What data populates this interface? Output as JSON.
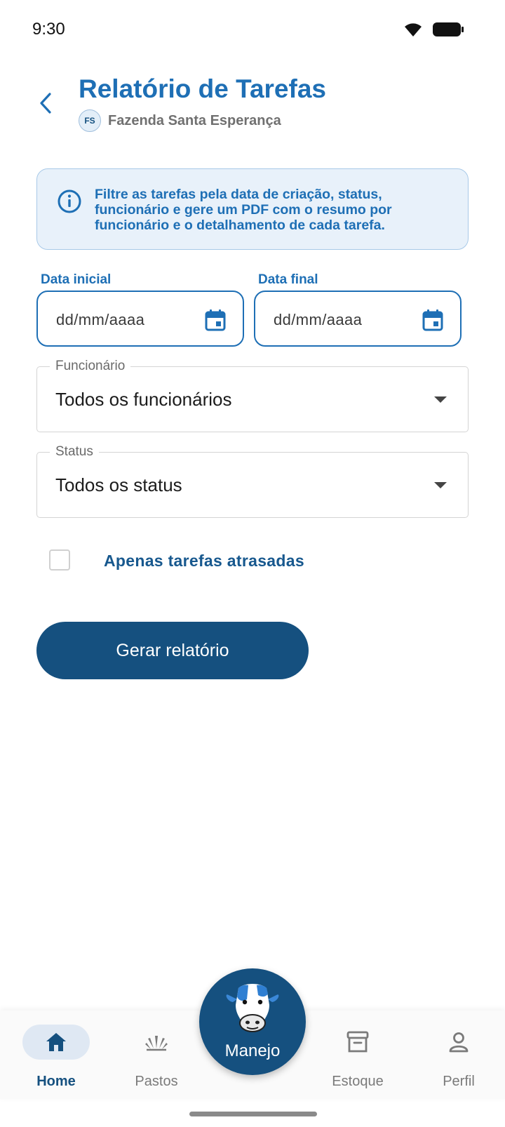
{
  "status_bar": {
    "time": "9:30"
  },
  "header": {
    "title": "Relatório de Tarefas",
    "farm_initials": "FS",
    "farm_name": "Fazenda Santa Esperança"
  },
  "info_card": {
    "text": "Filtre as tarefas pela data de criação, status, funcionário e gere um PDF com o resumo por funcionário e o detalhamento de cada tarefa."
  },
  "filters": {
    "start_date": {
      "label": "Data inicial",
      "placeholder": "dd/mm/aaaa"
    },
    "end_date": {
      "label": "Data final",
      "placeholder": "dd/mm/aaaa"
    },
    "employee": {
      "label": "Funcionário",
      "value": "Todos os funcionários"
    },
    "status": {
      "label": "Status",
      "value": "Todos os status"
    },
    "overdue_only": {
      "label": "Apenas tarefas atrasadas",
      "checked": false
    }
  },
  "actions": {
    "generate_label": "Gerar relatório"
  },
  "bottom_nav": {
    "items": [
      {
        "label": "Home",
        "icon": "home-icon",
        "active": true
      },
      {
        "label": "Pastos",
        "icon": "grass-icon",
        "active": false
      },
      {
        "label": "Manejo",
        "icon": "cow-icon",
        "active": false
      },
      {
        "label": "Estoque",
        "icon": "archive-icon",
        "active": false
      },
      {
        "label": "Perfil",
        "icon": "person-icon",
        "active": false
      }
    ]
  },
  "colors": {
    "primary": "#1e6fb5",
    "primary_dark": "#15507f",
    "info_bg": "#e8f1fa"
  }
}
